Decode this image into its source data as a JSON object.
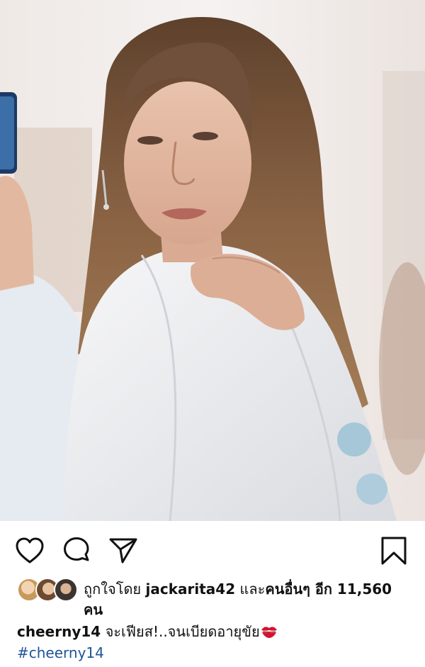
{
  "post": {
    "image": {
      "description_icon": "portrait-photo"
    },
    "actions": {
      "like_icon": "heart-outline-icon",
      "comment_icon": "comment-bubble-icon",
      "share_icon": "paper-plane-icon",
      "save_icon": "bookmark-outline-icon"
    },
    "likes": {
      "prefix": "ถูกใจโดย",
      "first_liker": "jackarita42",
      "connector": "และ",
      "others_label": "คนอื่นๆ อีก 11,560",
      "suffix": "คน"
    },
    "caption": {
      "username": "cheerny14",
      "text": "จะเฟียส!..จนเบียดอายุขัย",
      "emoji_icon": "kiss-mark-icon",
      "hashtag": "#cheerny14"
    },
    "colors": {
      "hashtag": "#1e5499",
      "text": "#111111",
      "kiss": "#d8102c"
    }
  }
}
